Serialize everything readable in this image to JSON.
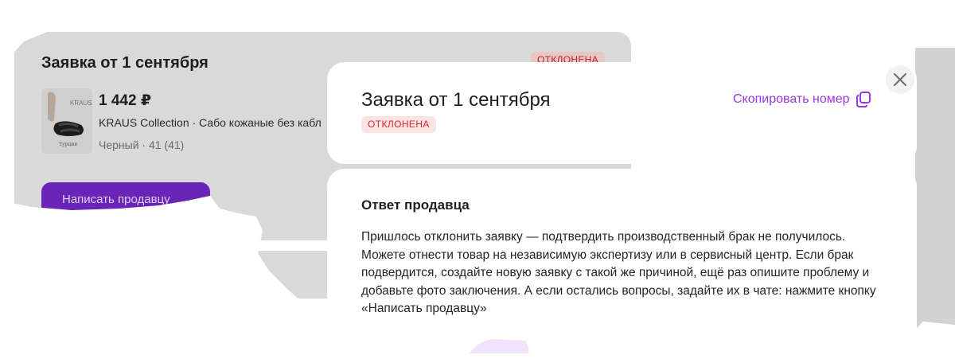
{
  "background_order": {
    "title": "Заявка от 1 сентября",
    "status_badge": "ОТКЛОНЕНА",
    "price": "1 442 ₽",
    "product_name": "KRAUS Collection · Сабо кожаные без кабл",
    "variant": "Черный · 41 (41)",
    "thumb_brand": "KRAUS",
    "write_seller_button": "Написать продавцу"
  },
  "modal": {
    "title": "Заявка от 1 сентября",
    "status_badge": "ОТКЛОНЕНА",
    "copy_number_link": "Скопировать номер",
    "copy_icon": "copy-icon",
    "close_icon": "close-icon",
    "seller_answer": {
      "title": "Ответ продавца",
      "text": "Пришлось отклонить заявку — подтвердить производственный брак не получилось. Можете отнести товар на независимую экспертизу или в сервисный центр. Если брак подвердится, создайте новую заявку с такой же причиной, ещё раз опишите проблему и добавьте фото заключения. А если остались вопросы, задайте их в чате: нажмите кнопку «Написать продавцу»"
    }
  },
  "colors": {
    "accent": "#9b36e6",
    "button": "#6a25b8",
    "reject_text": "#d7262f",
    "reject_bg": "#fde4e4"
  }
}
